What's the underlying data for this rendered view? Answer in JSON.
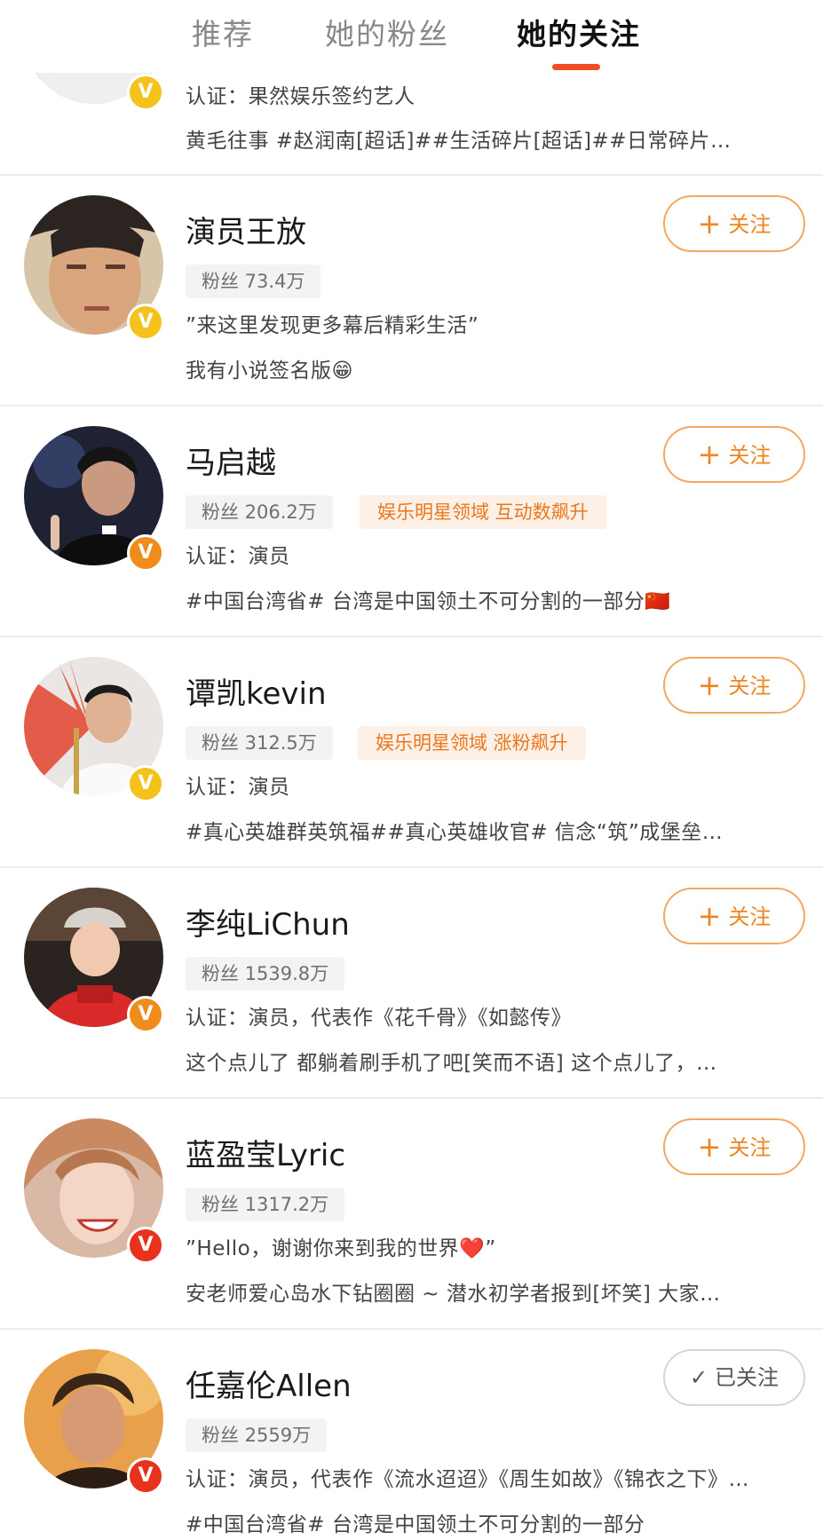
{
  "tabs": [
    {
      "label": "推荐"
    },
    {
      "label": "她的粉丝"
    },
    {
      "label": "她的关注",
      "active": true
    }
  ],
  "colors": {
    "accent": "#ee8520",
    "indicator": "#f04e22",
    "tag_bg": "#fdf0e6",
    "badge_gold": "#f5c21b",
    "badge_orange": "#f08c1c",
    "badge_red": "#e8321b"
  },
  "partial_item": {
    "line1": "认证：果然娱乐签约艺人",
    "line2": "黄毛往事 #赵润南[超话]##生活碎片[超话]##日常碎片…",
    "badge": "V"
  },
  "items": [
    {
      "name": "演员王放",
      "fans": "粉丝 73.4万",
      "line1": "”来这里发现更多幕后精彩生活”",
      "line2": "我有小说签名版😁",
      "badge": "V",
      "button": "关注",
      "button_icon": "plus-icon"
    },
    {
      "name": "马启越",
      "fans": "粉丝 206.2万",
      "tag": "娱乐明星领域  互动数飙升",
      "line1": "认证：演员",
      "line2": "#中国台湾省# 台湾是中国领土不可分割的一部分🇨🇳",
      "badge": "V",
      "button": "关注",
      "button_icon": "plus-icon"
    },
    {
      "name": "谭凯kevin",
      "fans": "粉丝 312.5万",
      "tag": "娱乐明星领域  涨粉飙升",
      "line1": "认证：演员",
      "line2": "#真心英雄群英筑福##真心英雄收官# 信念“筑”成堡垒…",
      "badge": "V",
      "button": "关注",
      "button_icon": "plus-icon"
    },
    {
      "name": "李纯LiChun",
      "fans": "粉丝 1539.8万",
      "line1": "认证：演员，代表作《花千骨》《如懿传》",
      "line2": "这个点儿了 都躺着刷手机了吧[笑而不语] 这个点儿了，…",
      "badge": "V",
      "button": "关注",
      "button_icon": "plus-icon"
    },
    {
      "name": "蓝盈莹Lyric",
      "fans": "粉丝 1317.2万",
      "line1": "”Hello，谢谢你来到我的世界❤️”",
      "line2": "安老师爱心岛水下钻圈圈 ~ 潜水初学者报到[坏笑] 大家…",
      "badge": "V",
      "button": "关注",
      "button_icon": "plus-icon"
    },
    {
      "name": "任嘉伦Allen",
      "fans": "粉丝 2559万",
      "line1": "认证：演员，代表作《流水迢迢》《周生如故》《锦衣之下》…",
      "line2": "#中国台湾省# 台湾是中国领土不可分割的一部分",
      "badge": "V",
      "button": "已关注",
      "button_icon": "check-icon"
    }
  ]
}
